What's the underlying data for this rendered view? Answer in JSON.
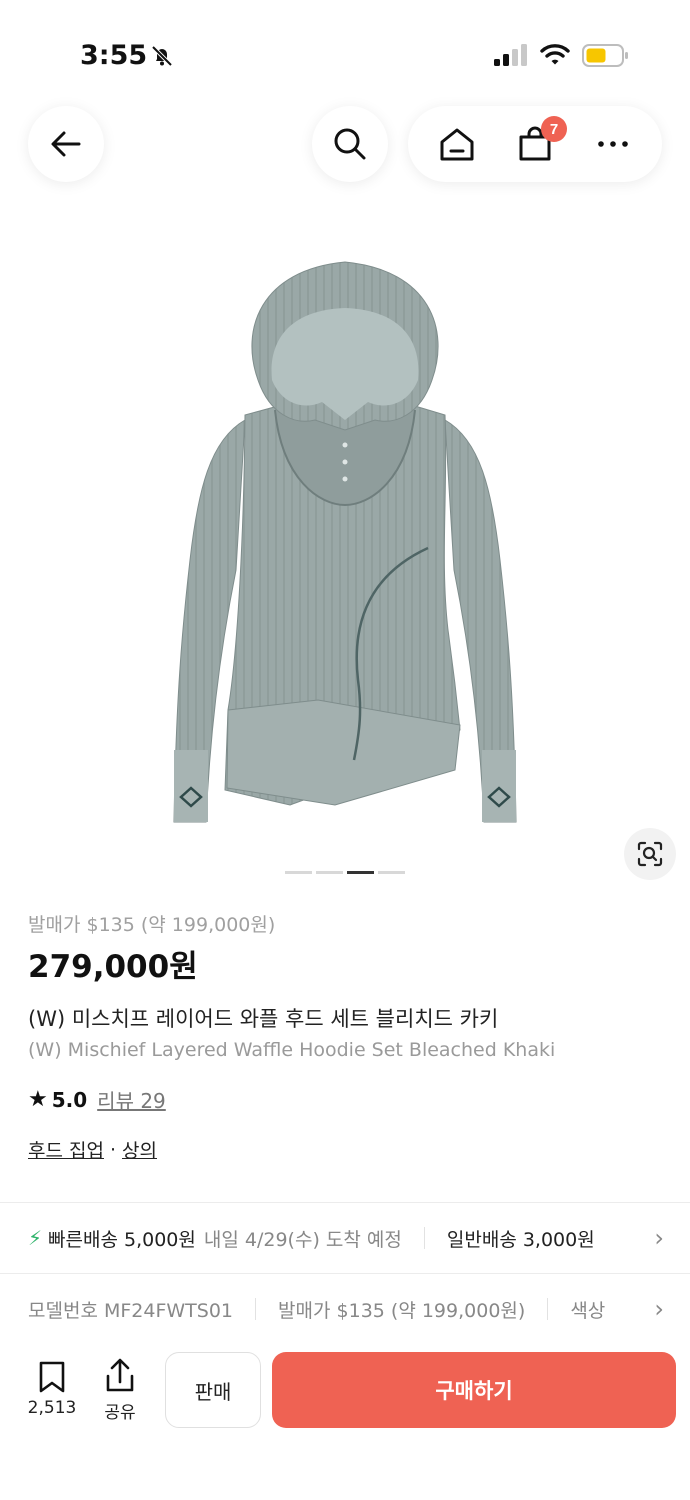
{
  "status_bar": {
    "time": "3:55"
  },
  "nav": {
    "cart_count": "7"
  },
  "product": {
    "release_price": "발매가 $135 (약 199,000원)",
    "price": "279,000원",
    "name_ko": "(W) 미스치프 레이어드 와플 후드 세트 블리치드 카키",
    "name_en": "(W) Mischief Layered Waffle Hoodie Set Bleached Khaki",
    "rating_score": "5.0",
    "review_label": "리뷰 29",
    "category_primary": "후드 집업",
    "category_sep": "·",
    "category_secondary": "상의",
    "image_count": 4,
    "image_index": 3
  },
  "shipping": {
    "fast_label": "빠른배송 5,000원",
    "fast_eta": "내일 4/29(수) 도착 예정",
    "normal_label": "일반배송 3,000원"
  },
  "spec": {
    "model": "모델번호 MF24FWTS01",
    "release": "발매가 $135 (약 199,000원)",
    "color_partial": "색상"
  },
  "bottom": {
    "wish_count": "2,513",
    "share_label": "공유",
    "sell_label": "판매",
    "buy_label": "구매하기"
  },
  "colors": {
    "accent": "#ef6253",
    "fast_ship": "#31b46c",
    "hoodie": "#9aa8a7"
  }
}
